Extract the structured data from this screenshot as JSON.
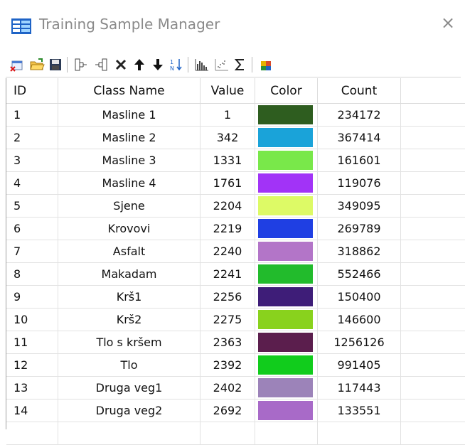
{
  "window": {
    "title": "Training Sample Manager",
    "close_glyph": "×"
  },
  "toolbar": {
    "icons": [
      "new-icon",
      "open-folder-icon",
      "save-icon",
      "merge-icon",
      "split-icon",
      "delete-icon",
      "move-up-icon",
      "move-down-icon",
      "sort-icon",
      "histogram-icon",
      "scatter-icon",
      "statistics-icon",
      "color-palette-icon"
    ]
  },
  "table": {
    "columns": [
      "ID",
      "Class Name",
      "Value",
      "Color",
      "Count"
    ],
    "rows": [
      {
        "id": "1",
        "name": "Masline 1",
        "value": "1",
        "color": "#2e5d1f",
        "count": "234172"
      },
      {
        "id": "2",
        "name": "Masline 2",
        "value": "342",
        "color": "#1aa3d9",
        "count": "367414"
      },
      {
        "id": "3",
        "name": "Masline 3",
        "value": "1331",
        "color": "#79e84a",
        "count": "161601"
      },
      {
        "id": "4",
        "name": "Masline 4",
        "value": "1761",
        "color": "#a233f7",
        "count": "119076"
      },
      {
        "id": "5",
        "name": "Sjene",
        "value": "2204",
        "color": "#ddfa66",
        "count": "349095"
      },
      {
        "id": "6",
        "name": "Krovovi",
        "value": "2219",
        "color": "#1f3fe3",
        "count": "269789"
      },
      {
        "id": "7",
        "name": "Asfalt",
        "value": "2240",
        "color": "#b375c8",
        "count": "318862"
      },
      {
        "id": "8",
        "name": "Makadam",
        "value": "2241",
        "color": "#22bb2c",
        "count": "552466"
      },
      {
        "id": "9",
        "name": "Krš1",
        "value": "2256",
        "color": "#3e1d78",
        "count": "150400"
      },
      {
        "id": "10",
        "name": "Krš2",
        "value": "2275",
        "color": "#89d21d",
        "count": "146600"
      },
      {
        "id": "11",
        "name": "Tlo s kršem",
        "value": "2363",
        "color": "#5b1e4d",
        "count": "1256126"
      },
      {
        "id": "12",
        "name": "Tlo",
        "value": "2392",
        "color": "#11cc1c",
        "count": "991405"
      },
      {
        "id": "13",
        "name": "Druga veg1",
        "value": "2402",
        "color": "#9c83b9",
        "count": "117443"
      },
      {
        "id": "14",
        "name": "Druga veg2",
        "value": "2692",
        "color": "#a86ac8",
        "count": "133551"
      }
    ]
  }
}
